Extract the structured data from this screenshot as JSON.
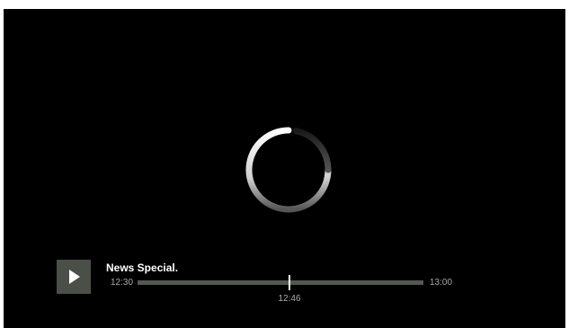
{
  "program": {
    "title": "News Special.",
    "start_time": "12:30",
    "end_time": "13:00",
    "current_time": "12:46",
    "progress": 0.533
  },
  "player": {
    "background_color": "#000000",
    "play_button_color": "#4a4f48",
    "track_color": "#525a50",
    "text_color": "#a9aca6",
    "play_icon": "play-icon",
    "spinner_icon": "loading-spinner-icon"
  }
}
